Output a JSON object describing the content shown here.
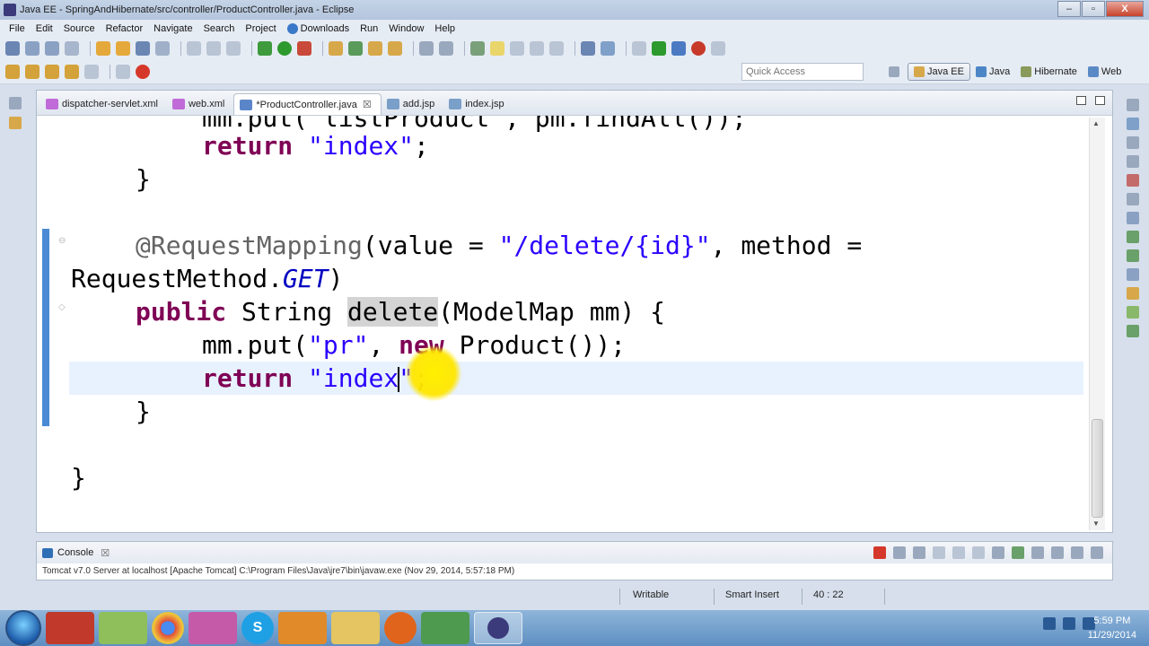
{
  "window": {
    "title": "Java EE - SpringAndHibernate/src/controller/ProductController.java - Eclipse",
    "minimize": "–",
    "maximize": "▫",
    "close": "X"
  },
  "menu": [
    "File",
    "Edit",
    "Source",
    "Refactor",
    "Navigate",
    "Search",
    "Project",
    "Downloads",
    "Run",
    "Window",
    "Help"
  ],
  "quick_access": {
    "placeholder": "Quick Access"
  },
  "perspectives": [
    "Java EE",
    "Java",
    "Hibernate",
    "Web"
  ],
  "tabs": [
    {
      "label": "dispatcher-servlet.xml",
      "icon_color": "#c06bd8"
    },
    {
      "label": "web.xml",
      "icon_color": "#c06bd8"
    },
    {
      "label": "*ProductController.java",
      "icon_color": "#5b85c9",
      "close": "☒"
    },
    {
      "label": "add.jsp",
      "icon_color": "#7a9fc8"
    },
    {
      "label": "index.jsp",
      "icon_color": "#7a9fc8"
    }
  ],
  "code": {
    "line1a": "mm.put(\"listProduct\", pm.findAll());",
    "return_kw": "return",
    "index_str": "\"index\"",
    "semicolon": ";",
    "close_brace": "}",
    "annotation": "@RequestMapping",
    "ann_open": "(value = ",
    "delete_path": "\"/delete/{id}\"",
    "method_eq": ", method =",
    "req_method": "RequestMethod.",
    "get_const": "GET",
    "paren_close": ")",
    "public_kw": "public",
    "string_type": " String ",
    "delete_name": "delete",
    "delete_params": "(ModelMap mm) {",
    "mm_put": "mm.put(",
    "pr_str": "\"pr\"",
    "comma": ", ",
    "new_kw": "new",
    "product_ctor": " Product());",
    "index_open": "\"index",
    "index_close": "\"",
    "class_close": "}"
  },
  "console": {
    "title": "Console",
    "close": "☒",
    "description": "Tomcat v7.0 Server at localhost [Apache Tomcat] C:\\Program Files\\Java\\jre7\\bin\\javaw.exe (Nov 29, 2014, 5:57:18 PM)"
  },
  "status": {
    "writable": "Writable",
    "insert_mode": "Smart Insert",
    "position": "40 : 22"
  },
  "taskbar": {
    "time": "5:59 PM",
    "date": "11/29/2014",
    "skype_letter": "S"
  },
  "colors": {
    "keyword": "#7f0055",
    "string": "#2a00ff",
    "annotation": "#646464",
    "constant": "#0000c0",
    "cursor_highlight": "#ffe600"
  }
}
